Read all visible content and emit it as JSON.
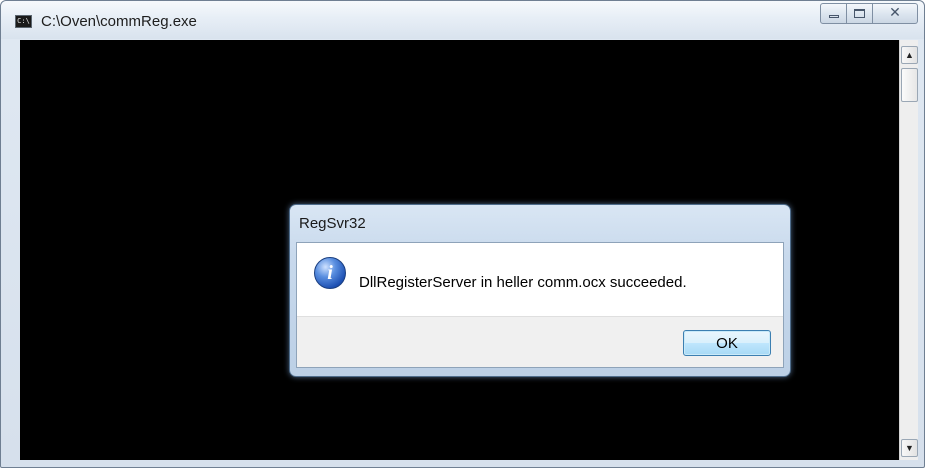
{
  "window": {
    "title": "C:\\Oven\\commReg.exe",
    "icon": "console-icon",
    "controls": {
      "minimize_icon": "minimize-icon",
      "maximize_icon": "maximize-icon",
      "close_glyph": "✕"
    }
  },
  "scrollbar": {
    "up_glyph": "▲",
    "down_glyph": "▼"
  },
  "dialog": {
    "title": "RegSvr32",
    "icon": "information-icon",
    "info_glyph": "i",
    "message": "DllRegisterServer in heller comm.ocx succeeded.",
    "ok_label": "OK"
  },
  "colors": {
    "console_background": "#000000",
    "dialog_accent": "#bcd0e6",
    "button_accent": "#a7d9f5"
  }
}
